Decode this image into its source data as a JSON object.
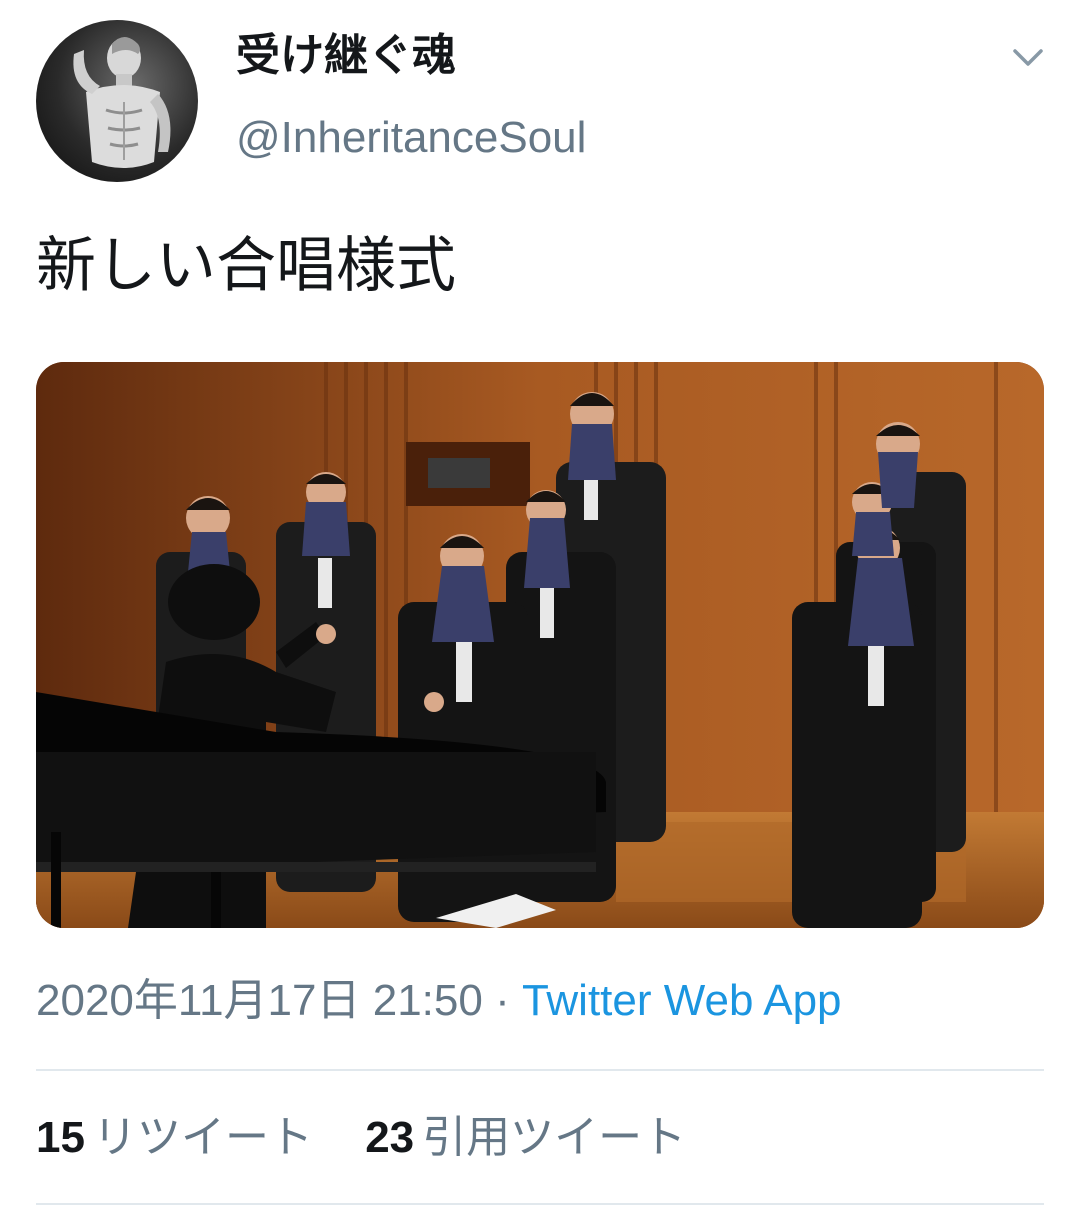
{
  "author": {
    "display_name": "受け継ぐ魂",
    "handle": "@InheritanceSoul",
    "avatar_icon": "statue-avatar-icon"
  },
  "tweet": {
    "text": "新しい合唱様式",
    "media_icon": "photo-choir-on-stage"
  },
  "meta": {
    "date": "2020年11月17日 21:50",
    "separator": " · ",
    "source": "Twitter Web App"
  },
  "stats": [
    {
      "count": "15",
      "label": "リツイート"
    },
    {
      "count": "23",
      "label": "引用ツイート"
    }
  ],
  "colors": {
    "text": "#14171a",
    "secondary": "#657786",
    "link": "#1b95e0",
    "divider": "#e1e8ed"
  }
}
